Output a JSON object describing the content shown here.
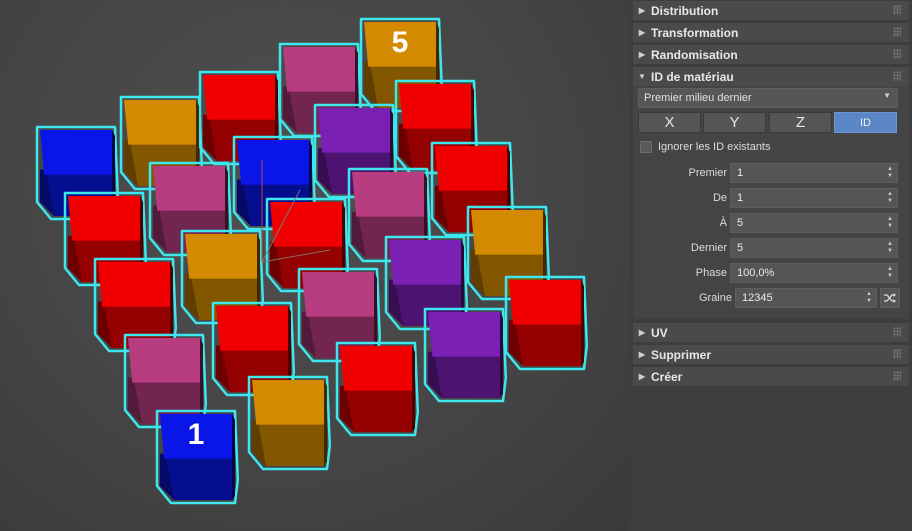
{
  "viewport": {
    "cube_labels": {
      "first": "1",
      "last": "5"
    },
    "colors": {
      "red": "#f00000",
      "orange": "#d48a00",
      "pink": "#b83c80",
      "purple": "#7a20b4",
      "blue": "#0a16e8",
      "selection": "#3ee6ee"
    }
  },
  "panel": {
    "rollouts_top": [
      {
        "label": "Distribution",
        "expanded": false
      },
      {
        "label": "Transformation",
        "expanded": false
      },
      {
        "label": "Randomisation",
        "expanded": false
      }
    ],
    "material_id": {
      "label": "ID de matériau",
      "expanded": true,
      "mode": "Premier milieu dernier",
      "axis_buttons": [
        "X",
        "Y",
        "Z",
        "ID"
      ],
      "active_axis": "ID",
      "ignore_existing_label": "Ignorer les ID existants",
      "ignore_existing_checked": false,
      "fields": [
        {
          "label": "Premier",
          "value": "1"
        },
        {
          "label": "De",
          "value": "1"
        },
        {
          "label": "À",
          "value": "5"
        },
        {
          "label": "Dernier",
          "value": "5"
        },
        {
          "label": "Phase",
          "value": "100,0%"
        },
        {
          "label": "Graine",
          "value": "12345"
        }
      ]
    },
    "rollouts_bottom": [
      {
        "label": "UV",
        "expanded": false
      },
      {
        "label": "Supprimer",
        "expanded": false
      },
      {
        "label": "Créer",
        "expanded": false
      }
    ]
  }
}
